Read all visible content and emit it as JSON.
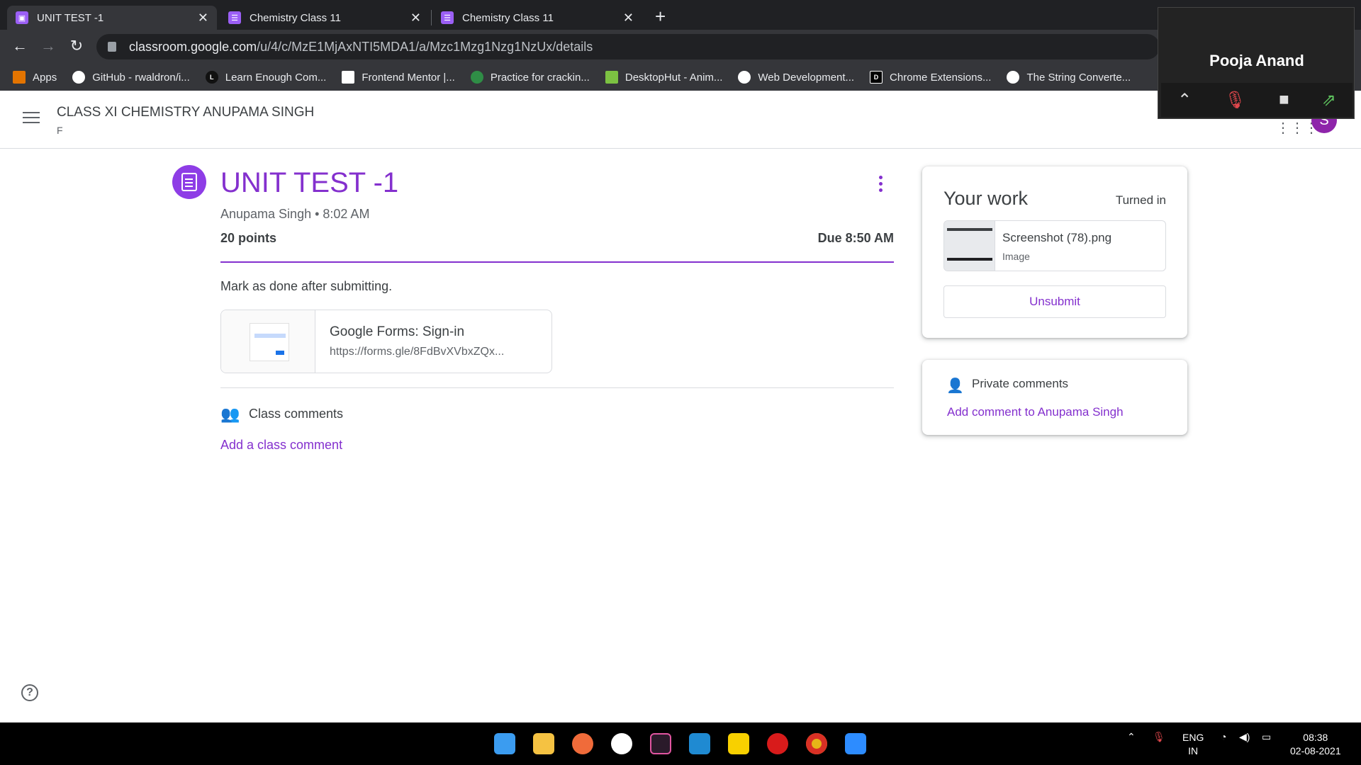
{
  "browser": {
    "tabs": [
      {
        "label": "UNIT TEST -1",
        "active": true
      },
      {
        "label": "Chemistry Class 11",
        "active": false
      },
      {
        "label": "Chemistry Class 11",
        "active": false
      }
    ],
    "url_host": "classroom.google.com",
    "url_path": "/u/4/c/MzE1MjAxNTI5MDA1/a/Mzc1Mzg1Nzg1NzUx/details",
    "bookmarks": [
      "Apps",
      "GitHub - rwaldron/i...",
      "Learn Enough Com...",
      "Frontend Mentor |...",
      "Practice for crackin...",
      "DesktopHut - Anim...",
      "Web Development...",
      "Chrome Extensions...",
      "The String Converte..."
    ]
  },
  "zoom": {
    "name": "Pooja Anand"
  },
  "header": {
    "class_title": "CLASS XI CHEMISTRY ANUPAMA SINGH",
    "class_section": "F",
    "avatar_letter": "S"
  },
  "assignment": {
    "title": "UNIT TEST -1",
    "meta": "Anupama Singh • 8:02 AM",
    "points": "20 points",
    "due": "Due 8:50 AM",
    "description": "Mark as done after submitting.",
    "attachment_title": "Google Forms: Sign-in",
    "attachment_url": "https://forms.gle/8FdBvXVbxZQx...",
    "class_comments_label": "Class comments",
    "add_class_comment": "Add a class comment"
  },
  "your_work": {
    "title": "Your work",
    "status": "Turned in",
    "file_name": "Screenshot (78).png",
    "file_type": "Image",
    "unsubmit_label": "Unsubmit"
  },
  "private_comments": {
    "label": "Private comments",
    "add_link": "Add comment to Anupama Singh"
  },
  "system": {
    "lang": "ENG",
    "region": "IN",
    "time": "08:38",
    "date": "02-08-2021"
  },
  "colors": {
    "accent": "#8430ce",
    "chrome_dark": "#202124",
    "chrome_mid": "#35363a"
  }
}
